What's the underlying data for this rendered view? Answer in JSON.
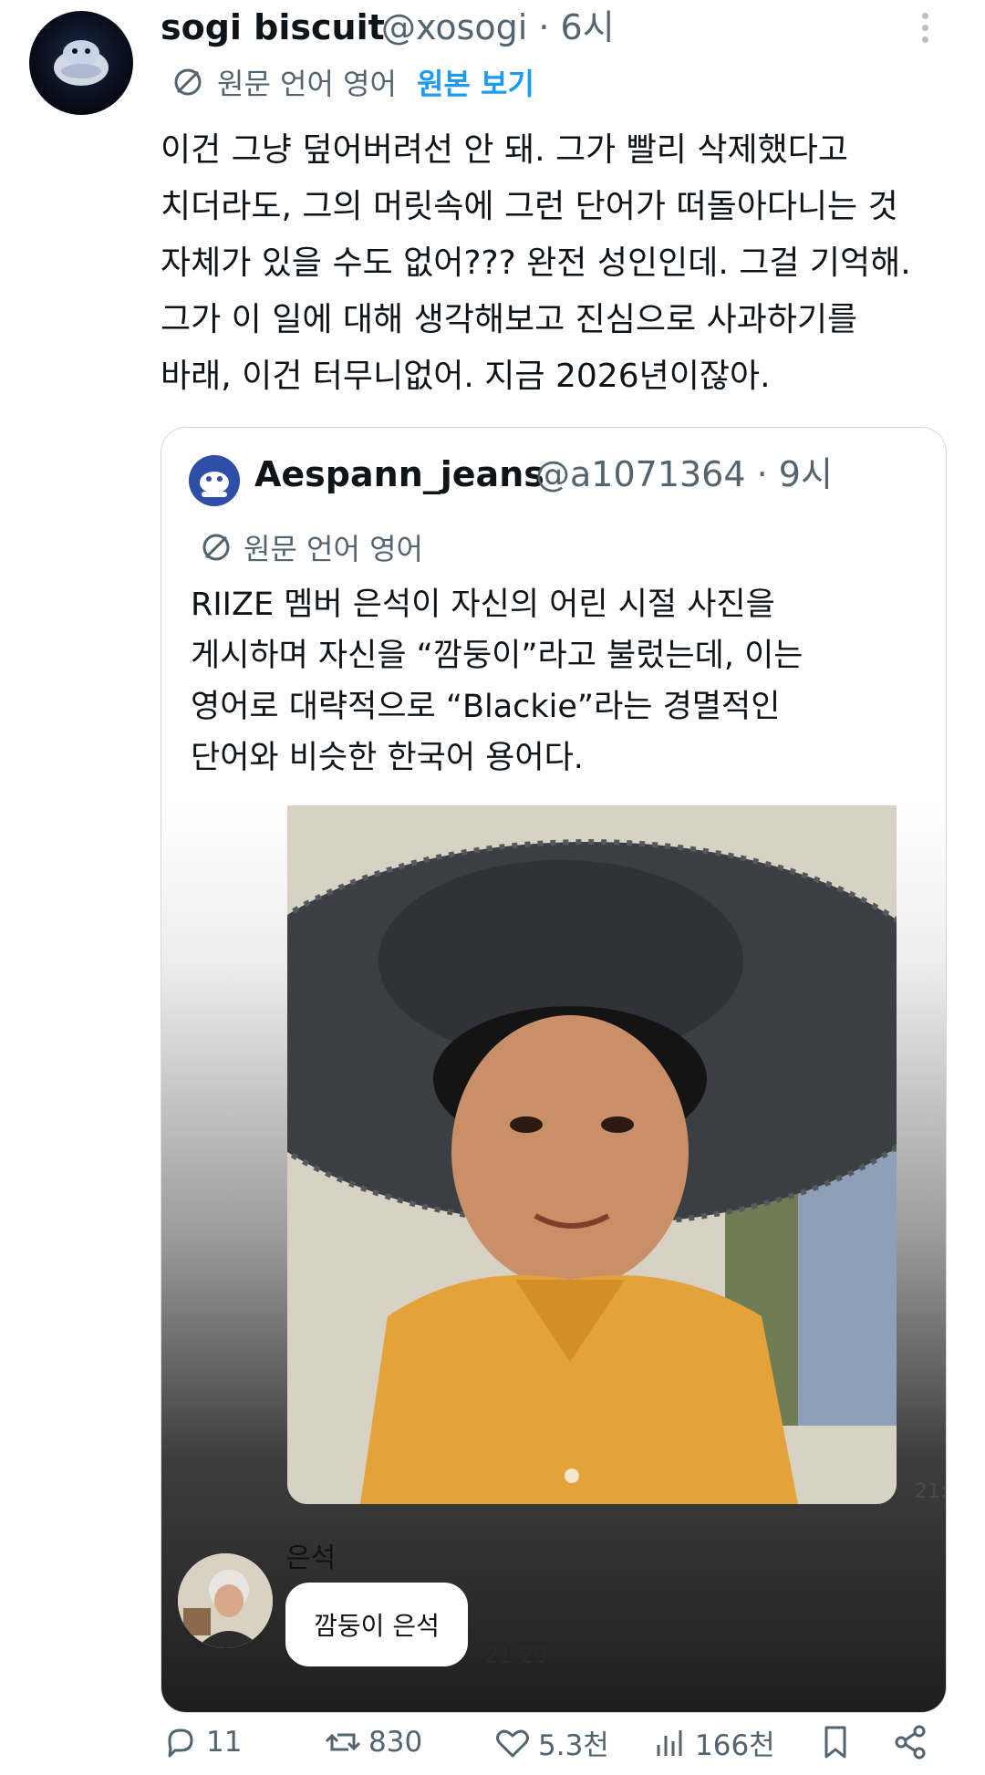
{
  "author": {
    "display_name": "sogi biscuit",
    "handle_time": "@xosogi · 6시"
  },
  "translation": {
    "label": "원문 언어 영어",
    "view_original": "원본 보기"
  },
  "post_lines": [
    "이건 그냥 덮어버려선 안 돼. 그가 빨리 삭제했다고",
    "치더라도, 그의 머릿속에 그런 단어가 떠돌아다니는 것",
    "자체가 있을 수도 없어??? 완전 성인인데. 그걸 기억해.",
    "그가 이 일에 대해 생각해보고 진심으로 사과하기를",
    "바래, 이건 터무니없어. 지금 2026년이잖아."
  ],
  "quote": {
    "display_name": "Aespann_jeans",
    "handle_time": "@a1071364 · 9시",
    "translation_label": "원문 언어 영어",
    "lines": [
      "RIIZE 멤버 은석이 자신의 어린 시절 사진을",
      "게시하며 자신을 “깜둥이”라고 불렀는데, 이는",
      "영어로 대략적으로 “Blackie”라는 경멸적인",
      "단어와 비슷한 한국어 용어다."
    ],
    "media": {
      "timestamp_1": "21:",
      "chat_name": "은석",
      "chat_message": "깜둥이 은석",
      "timestamp_2": "21:29"
    }
  },
  "actions": {
    "replies": "11",
    "reposts": "830",
    "likes": "5.3천",
    "views": "166천"
  },
  "icons": {
    "translate": "translate-icon",
    "reply": "reply-icon",
    "repost": "repost-icon",
    "like": "heart-icon",
    "views": "views-icon",
    "bookmark": "bookmark-icon",
    "share": "share-icon",
    "more": "more-vertical-icon"
  },
  "colors": {
    "link": "#1d9bf0",
    "secondary_text": "#536471",
    "border": "#cfd9de"
  }
}
